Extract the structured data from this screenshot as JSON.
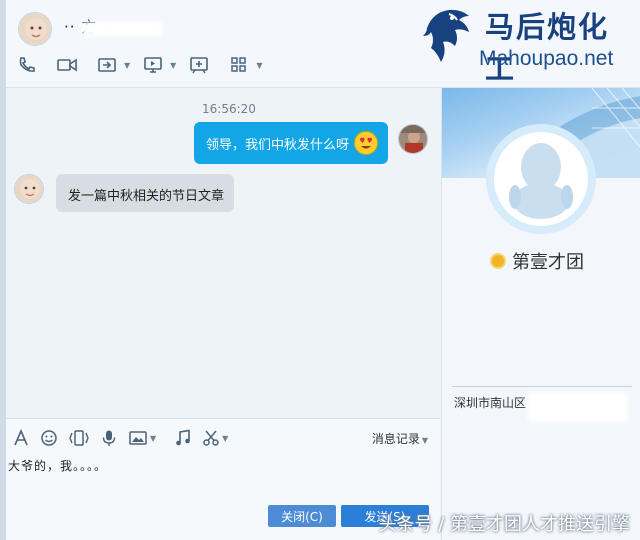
{
  "header": {
    "contact_name": "·· 方 ·· ·· ·· ·",
    "toolbar": [
      "phone-icon",
      "video-icon",
      "share-screen-icon",
      "remote-desktop-icon",
      "whiteboard-icon",
      "apps-icon"
    ]
  },
  "brand": {
    "name_cn": "马后炮化工",
    "name_en": "Mahoupao.net"
  },
  "chat": {
    "timestamp": "16:56:20",
    "messages": [
      {
        "from": "me",
        "text": "领导，我们中秋发什么呀",
        "emoji": "heart-eyes-emoji"
      },
      {
        "from": "them",
        "text": "发一篇中秋相关的节日文章"
      }
    ]
  },
  "profile": {
    "name": "第壹才团",
    "location": "深圳市南山区"
  },
  "input": {
    "toolbar": [
      "font-icon",
      "emoji-icon",
      "shake-icon",
      "voice-icon",
      "image-icon",
      "music-icon",
      "screenshot-icon"
    ],
    "history_label": "消息记录",
    "draft": "大爷的，我。。。。",
    "close_label": "关闭(C)",
    "send_label": "发送(S)"
  },
  "footer_watermark": "头条号 / 第壹才团人才推送引擎",
  "colors": {
    "outgoing_bubble": "#12a6e7",
    "incoming_bubble": "#d6dde3",
    "send_button": "#2b7fd6",
    "brand": "#17417f"
  }
}
